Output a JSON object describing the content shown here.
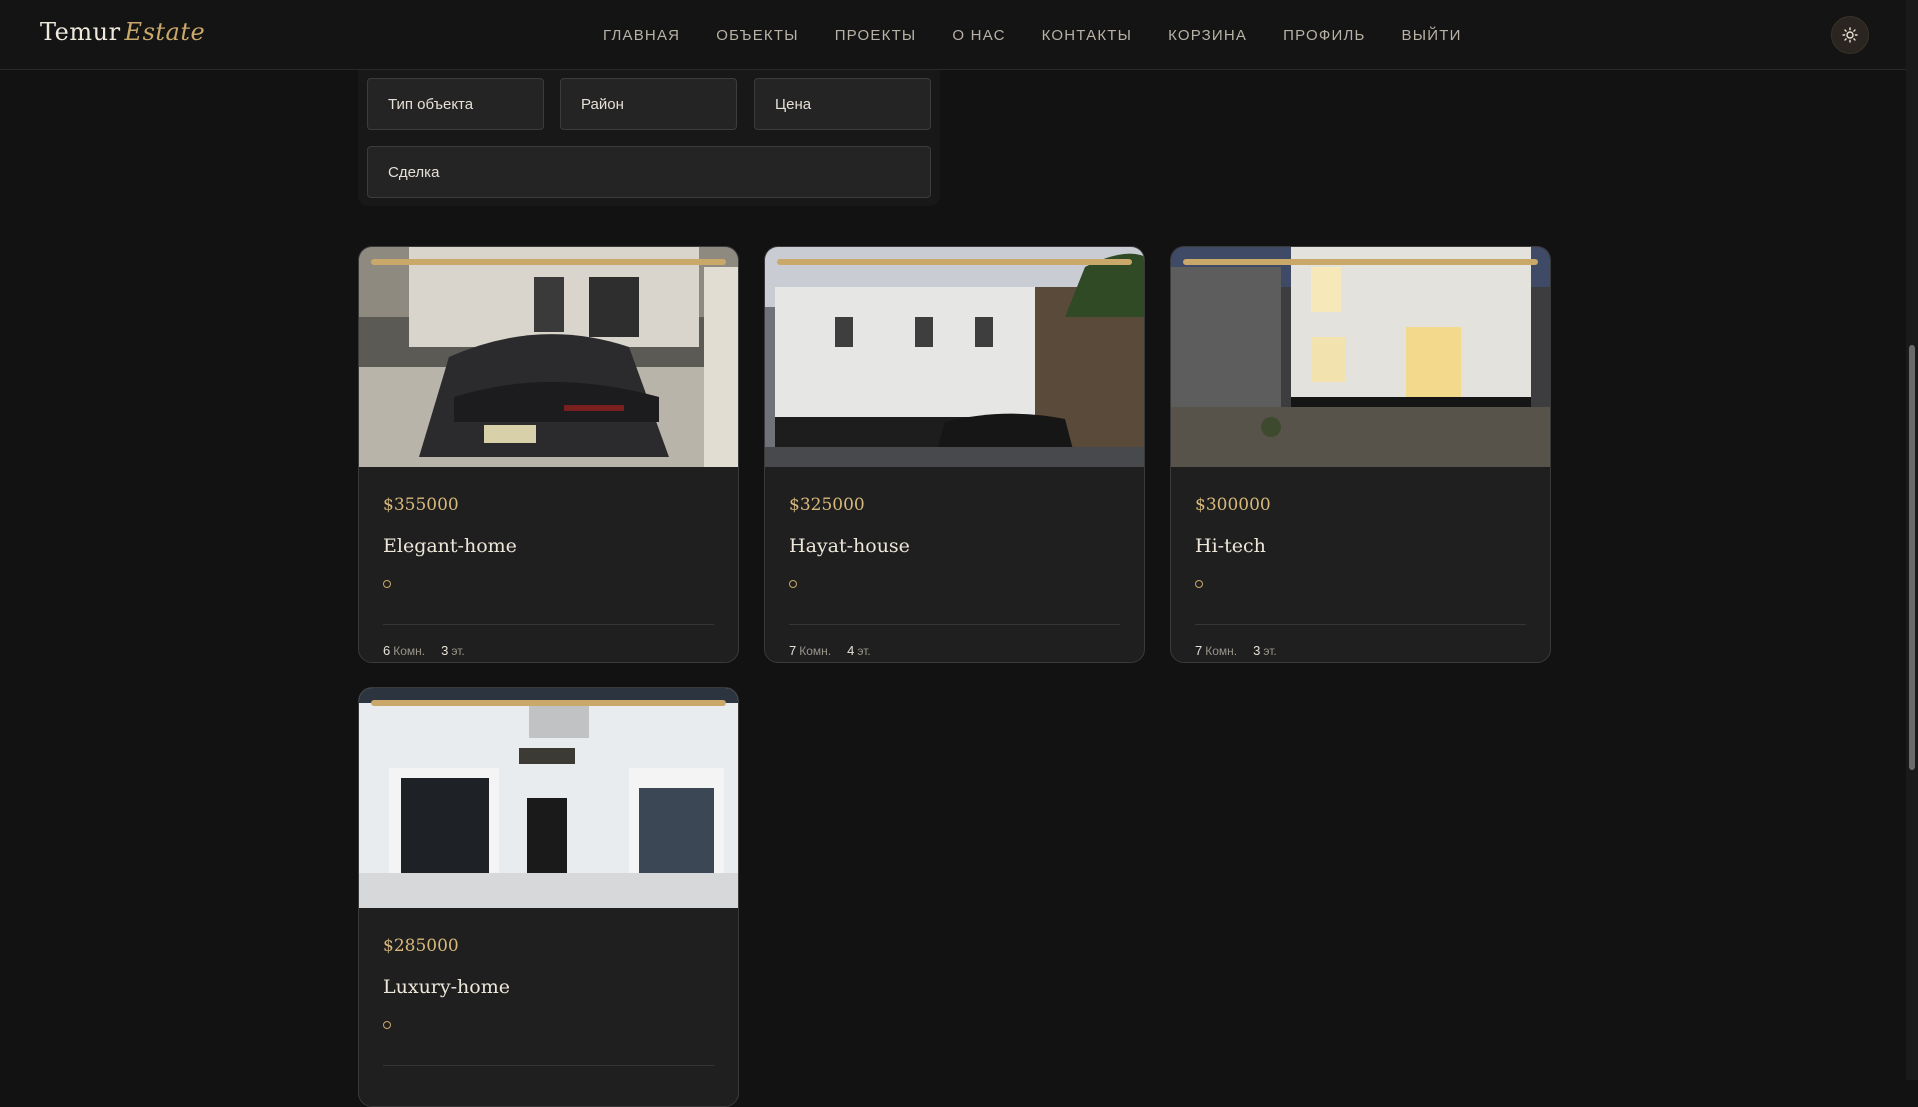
{
  "header": {
    "logo_main": "Temur",
    "logo_accent": "Estate",
    "nav": [
      "ГЛАВНАЯ",
      "ОБЪЕКТЫ",
      "ПРОЕКТЫ",
      "О НАС",
      "КОНТАКТЫ",
      "КОРЗИНА",
      "ПРОФИЛЬ",
      "ВЫЙТИ"
    ],
    "theme_icon": "sun-icon"
  },
  "filters": {
    "type": "Тип объекта",
    "district": "Район",
    "price": "Цена",
    "deal": "Сделка"
  },
  "listings": [
    {
      "price": "$355000",
      "title": "Elegant-home",
      "rooms": "6",
      "rooms_label": "Комн.",
      "floors": "3",
      "floors_label": "эт."
    },
    {
      "price": "$325000",
      "title": "Hayat-house",
      "rooms": "7",
      "rooms_label": "Комн.",
      "floors": "4",
      "floors_label": "эт."
    },
    {
      "price": "$300000",
      "title": "Hi-tech",
      "rooms": "7",
      "rooms_label": "Комн.",
      "floors": "3",
      "floors_label": "эт."
    },
    {
      "price": "$285000",
      "title": "Luxury-home"
    }
  ],
  "colors": {
    "accent": "#c9a86a",
    "background": "#121212",
    "card": "#1f1f1f"
  }
}
